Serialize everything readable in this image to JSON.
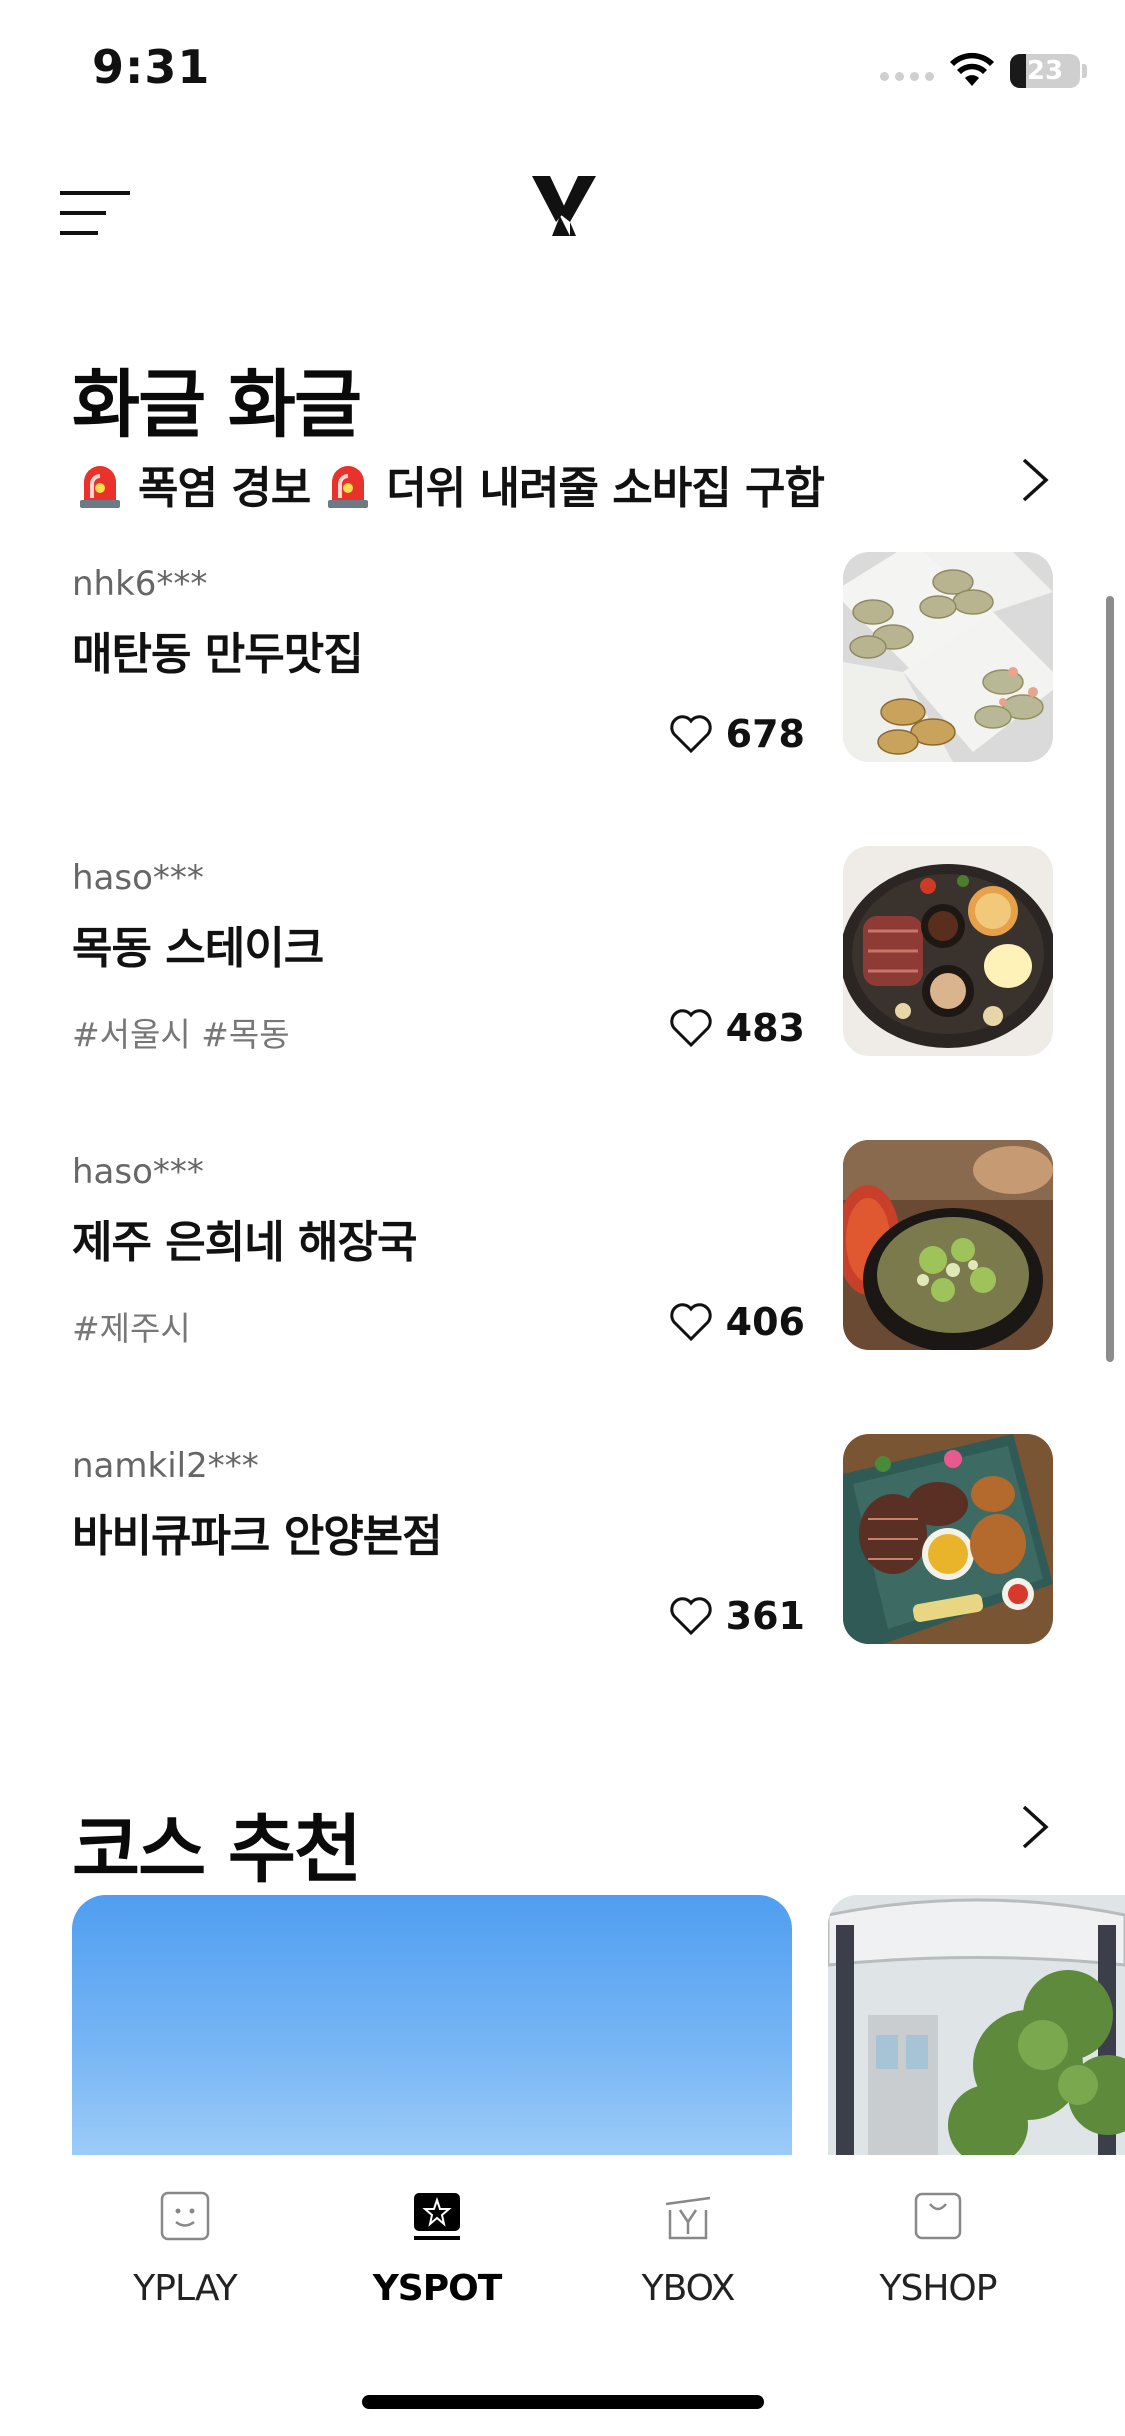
{
  "status_bar": {
    "time": "9:31",
    "battery": "23",
    "battery_level": 0.23
  },
  "header": {
    "menu_icon": "menu-icon",
    "logo_icon": "y-logo-icon"
  },
  "hot_section": {
    "title": "화글 화글",
    "subtitle_part1": "폭염 경보",
    "subtitle_part2": "더위 내려줄 소바집 구합",
    "siren_icon": "siren-emoji",
    "items": [
      {
        "user": "nhk6***",
        "name": "매탄동 만두맛집",
        "tags": "",
        "likes": "678"
      },
      {
        "user": "haso***",
        "name": "목동 스테이크",
        "tags": "#서울시 #목동",
        "likes": "483"
      },
      {
        "user": "haso***",
        "name": "제주 은희네 해장국",
        "tags": "#제주시",
        "likes": "406"
      },
      {
        "user": "namkil2***",
        "name": "바비큐파크 안양본점",
        "tags": "",
        "likes": "361"
      }
    ]
  },
  "course_section": {
    "title": "코스 추천"
  },
  "tab_bar": {
    "tabs": [
      {
        "label": "YPLAY",
        "icon": "smile-face-icon"
      },
      {
        "label": "YSPOT",
        "icon": "star-icon",
        "active": true
      },
      {
        "label": "YBOX",
        "icon": "gift-box-icon"
      },
      {
        "label": "YSHOP",
        "icon": "shopping-bag-icon"
      }
    ]
  },
  "colors": {
    "accent": "#000000",
    "muted": "#777777",
    "heart_stroke": "#111111",
    "sky": "#4f9ef0"
  }
}
